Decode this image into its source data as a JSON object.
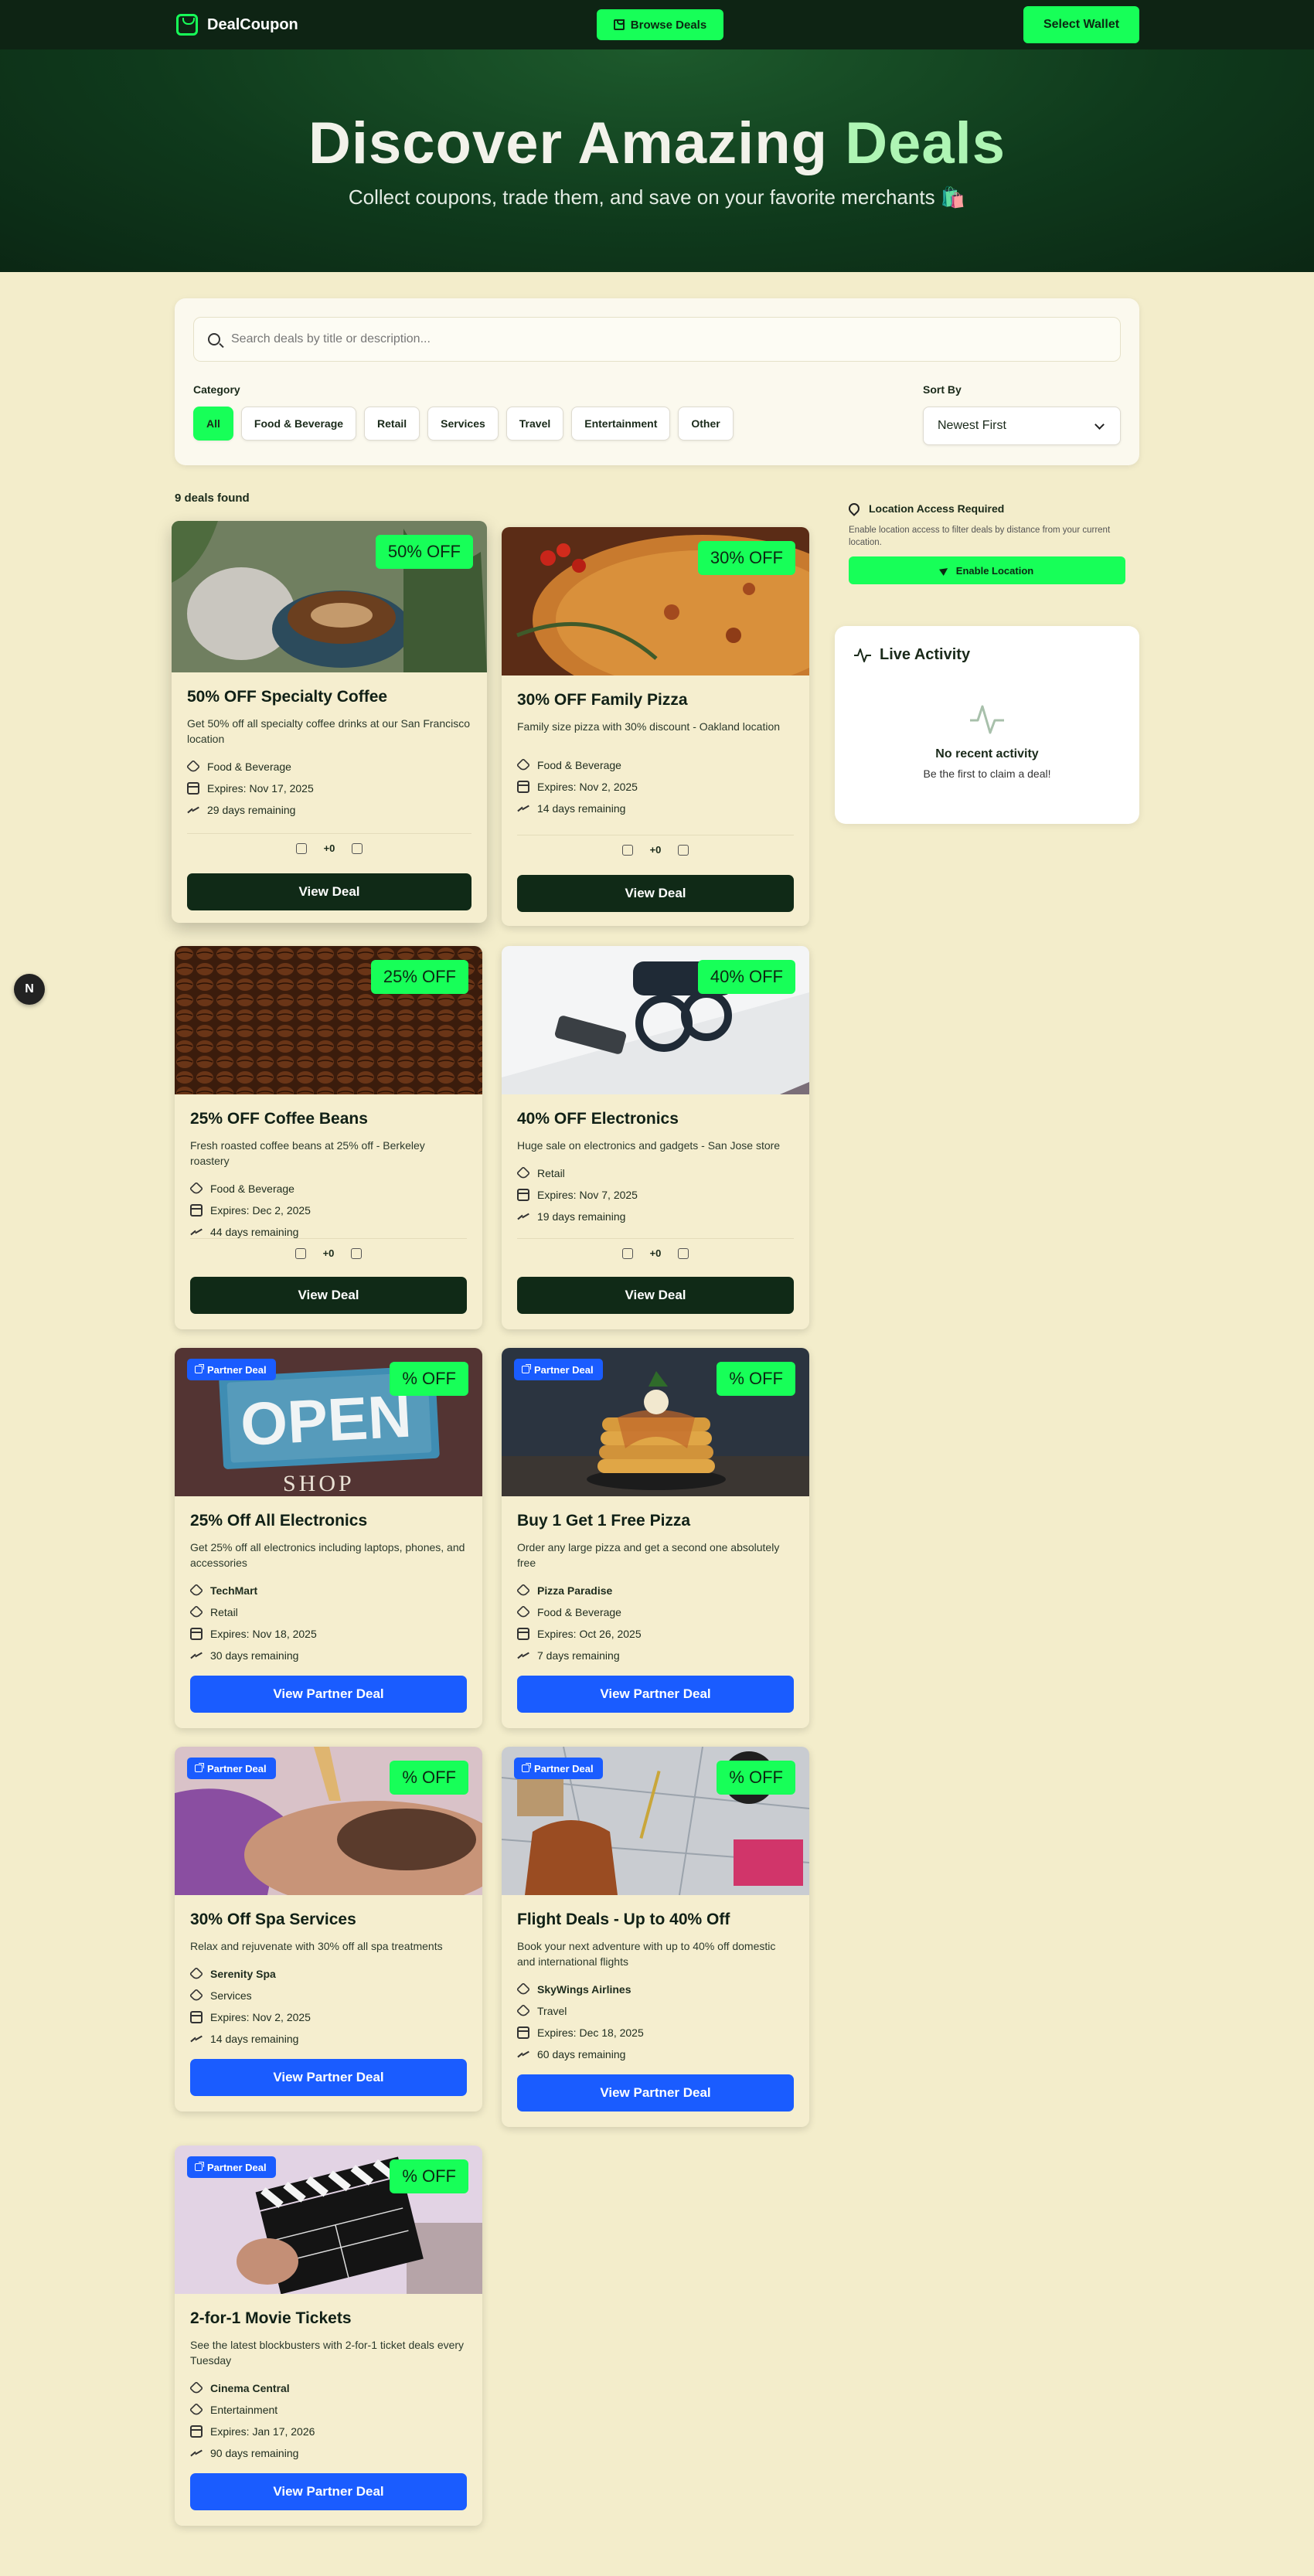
{
  "nav": {
    "brand": "DealCoupon",
    "browse_label": "Browse Deals",
    "wallet_label": "Select Wallet"
  },
  "hero": {
    "title_main": "Discover Amazing",
    "title_accent": "Deals",
    "subtitle": "Collect coupons, trade them, and save on your favorite merchants 🛍️"
  },
  "filters": {
    "search_placeholder": "Search deals by title or description...",
    "category_label": "Category",
    "categories": [
      "All",
      "Food & Beverage",
      "Retail",
      "Services",
      "Travel",
      "Entertainment",
      "Other"
    ],
    "active_category": "All",
    "sort_label": "Sort By",
    "sort_value": "Newest First"
  },
  "results": {
    "count_text": "9 deals found"
  },
  "deals": [
    {
      "title": "50% OFF Specialty Coffee",
      "discount": "50% OFF",
      "description": "Get 50% off all specialty coffee drinks at our San Francisco location",
      "category": "Food & Beverage",
      "expires": "Expires: Nov 17, 2025",
      "remaining": "29 days remaining",
      "votes": "+0",
      "button": "View Deal"
    },
    {
      "title": "30% OFF Family Pizza",
      "discount": "30% OFF",
      "description": "Family size pizza with 30% discount - Oakland location",
      "category": "Food & Beverage",
      "expires": "Expires: Nov 2, 2025",
      "remaining": "14 days remaining",
      "votes": "+0",
      "button": "View Deal"
    },
    {
      "title": "25% OFF Coffee Beans",
      "discount": "25% OFF",
      "description": "Fresh roasted coffee beans at 25% off - Berkeley roastery",
      "category": "Food & Beverage",
      "expires": "Expires: Dec 2, 2025",
      "remaining": "44 days remaining",
      "votes": "+0",
      "button": "View Deal"
    },
    {
      "title": "40% OFF Electronics",
      "discount": "40% OFF",
      "description": "Huge sale on electronics and gadgets - San Jose store",
      "category": "Retail",
      "expires": "Expires: Nov 7, 2025",
      "remaining": "19 days remaining",
      "votes": "+0",
      "button": "View Deal"
    },
    {
      "title": "25% Off All Electronics",
      "discount": "% OFF",
      "badge": "Partner Deal",
      "description": "Get 25% off all electronics including laptops, phones, and accessories",
      "merchant": "TechMart",
      "category": "Retail",
      "expires": "Expires: Nov 18, 2025",
      "remaining": "30 days remaining",
      "button": "View Partner Deal"
    },
    {
      "title": "Buy 1 Get 1 Free Pizza",
      "discount": "% OFF",
      "badge": "Partner Deal",
      "description": "Order any large pizza and get a second one absolutely free",
      "merchant": "Pizza Paradise",
      "category": "Food & Beverage",
      "expires": "Expires: Oct 26, 2025",
      "remaining": "7 days remaining",
      "button": "View Partner Deal"
    },
    {
      "title": "30% Off Spa Services",
      "discount": "% OFF",
      "badge": "Partner Deal",
      "description": "Relax and rejuvenate with 30% off all spa treatments",
      "merchant": "Serenity Spa",
      "category": "Services",
      "expires": "Expires: Nov 2, 2025",
      "remaining": "14 days remaining",
      "button": "View Partner Deal"
    },
    {
      "title": "Flight Deals - Up to 40% Off",
      "discount": "% OFF",
      "badge": "Partner Deal",
      "description": "Book your next adventure with up to 40% off domestic and international flights",
      "merchant": "SkyWings Airlines",
      "category": "Travel",
      "expires": "Expires: Dec 18, 2025",
      "remaining": "60 days remaining",
      "button": "View Partner Deal"
    },
    {
      "title": "2-for-1 Movie Tickets",
      "discount": "% OFF",
      "badge": "Partner Deal",
      "description": "See the latest blockbusters with 2-for-1 ticket deals every Tuesday",
      "merchant": "Cinema Central",
      "category": "Entertainment",
      "expires": "Expires: Jan 17, 2026",
      "remaining": "90 days remaining",
      "button": "View Partner Deal"
    }
  ],
  "location": {
    "title": "Location Access Required",
    "description": "Enable location access to filter deals by distance from your current location.",
    "button": "Enable Location"
  },
  "activity": {
    "title": "Live Activity",
    "empty_title": "No recent activity",
    "empty_sub": "Be the first to claim a deal!"
  },
  "dev_badge": "N",
  "colors": {
    "accent": "#17ff58",
    "dark": "#0e2414",
    "partner": "#1a5cff",
    "background": "#f3edcb"
  }
}
